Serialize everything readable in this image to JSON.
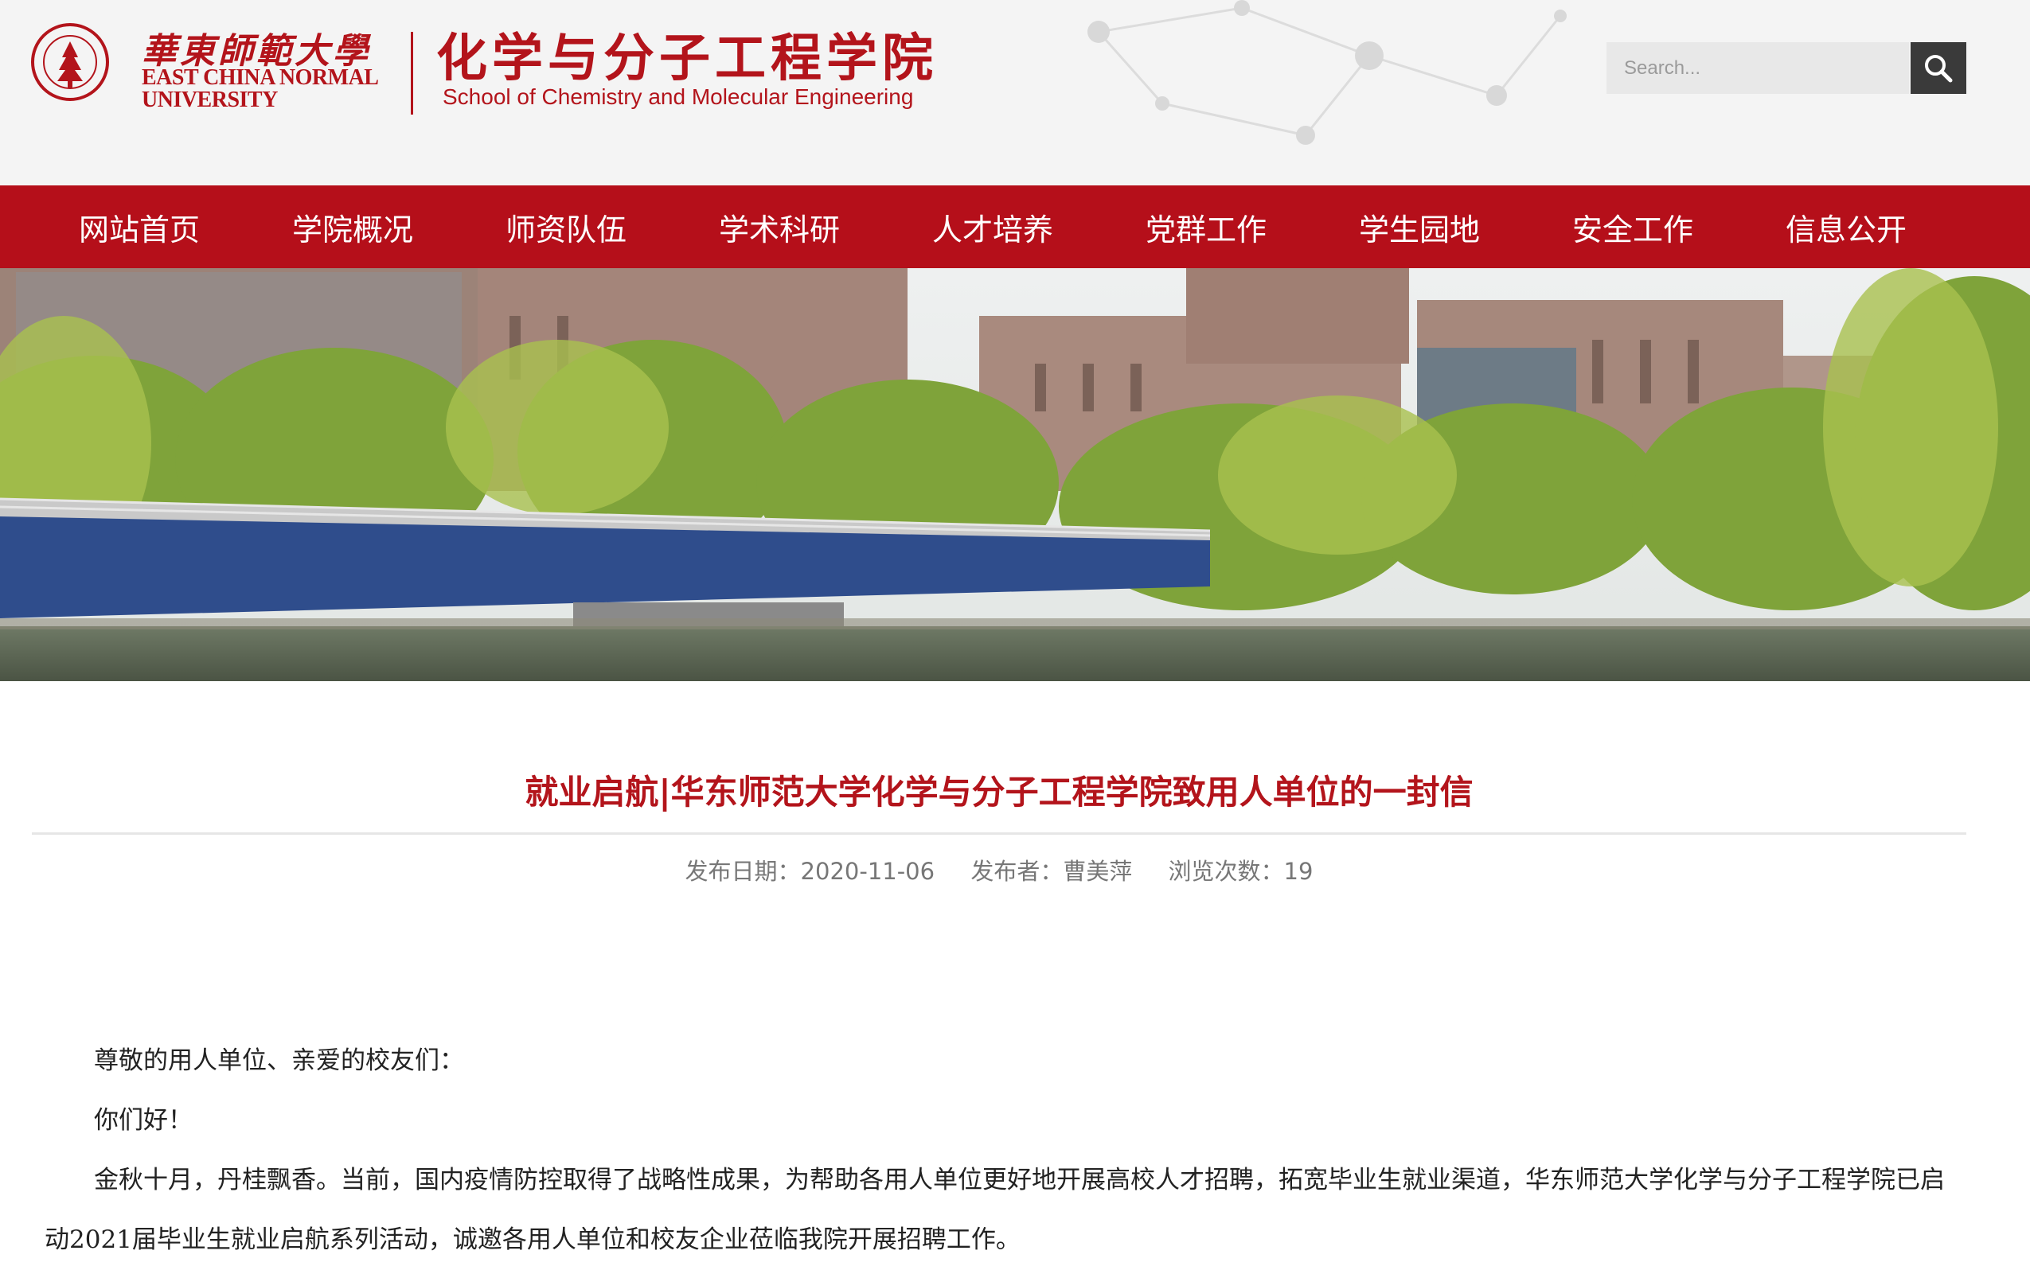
{
  "header": {
    "university_cn": "華東師範大學",
    "university_en_line1": "EAST CHINA NORMAL",
    "university_en_line2": "UNIVERSITY",
    "school_cn": "化学与分子工程学院",
    "school_en": "School of Chemistry and Molecular Engineering",
    "search_placeholder": "Search..."
  },
  "nav": {
    "items": [
      {
        "label": "网站首页"
      },
      {
        "label": "学院概况"
      },
      {
        "label": "师资队伍"
      },
      {
        "label": "学术科研"
      },
      {
        "label": "人才培养"
      },
      {
        "label": "党群工作"
      },
      {
        "label": "学生园地"
      },
      {
        "label": "安全工作"
      },
      {
        "label": "信息公开"
      }
    ]
  },
  "article": {
    "title": "就业启航|华东师范大学化学与分子工程学院致用人单位的一封信",
    "meta": {
      "date": "发布日期：2020-11-06",
      "author": "发布者：曹美萍",
      "views": "浏览次数：19"
    },
    "paragraphs": [
      "尊敬的用人单位、亲爱的校友们：",
      "你们好！",
      "金秋十月，丹桂飘香。当前，国内疫情防控取得了战略性成果，为帮助各用人单位更好地开展高校人才招聘，拓宽毕业生就业渠道，华东师范大学化学与分子工程学院已启动2021届毕业生就业启航系列活动，诚邀各用人单位和校友企业莅临我院开展招聘工作。"
    ]
  },
  "colors": {
    "brand_red": "#b3141b",
    "nav_red": "#b50f1a",
    "search_button": "#3a3a3a"
  },
  "icons": {
    "search": "magnifier-icon",
    "logo": "ecnu-seal-icon"
  }
}
